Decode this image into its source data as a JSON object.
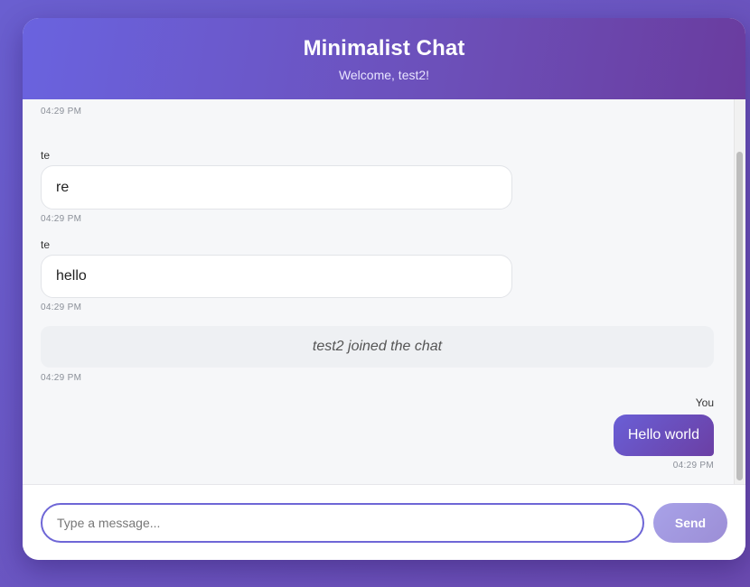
{
  "header": {
    "title": "Minimalist Chat",
    "subtitle": "Welcome, test2!"
  },
  "messages": [
    {
      "kind": "timestamp-only",
      "time": "04:29 PM"
    },
    {
      "kind": "incoming",
      "sender": "te",
      "text": "re",
      "time": "04:29 PM"
    },
    {
      "kind": "incoming",
      "sender": "te",
      "text": "hello",
      "time": "04:29 PM"
    },
    {
      "kind": "system",
      "text": "test2 joined the chat",
      "time": "04:29 PM"
    },
    {
      "kind": "outgoing",
      "sender": "You",
      "text": "Hello world",
      "time": "04:29 PM"
    }
  ],
  "composer": {
    "placeholder": "Type a message...",
    "value": "",
    "send_label": "Send"
  },
  "colors": {
    "accent": "#6a5fd6",
    "header_start": "#6a63df",
    "header_end": "#6a3c9f",
    "page_bg": "#6a5fd0"
  }
}
